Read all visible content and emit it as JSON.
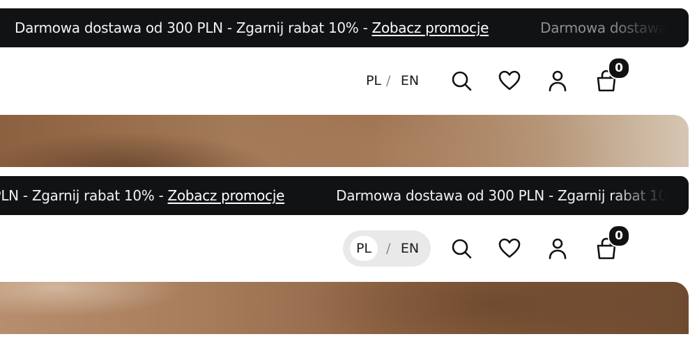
{
  "promo": {
    "text": "Darmowa dostawa od 300 PLN - Zgarnij rabat 10% - ",
    "link": "Zobacz promocje"
  },
  "language": {
    "pl": "PL",
    "separator": "/",
    "en": "EN"
  },
  "icons": {
    "search": "search-icon",
    "wishlist": "heart-icon",
    "account": "user-icon",
    "cart": "shopping-bag-icon"
  },
  "cart": {
    "count": "0"
  },
  "colors": {
    "promo_bg": "#111214",
    "text": "#111111",
    "lang_pill": "#e9e9ea"
  }
}
